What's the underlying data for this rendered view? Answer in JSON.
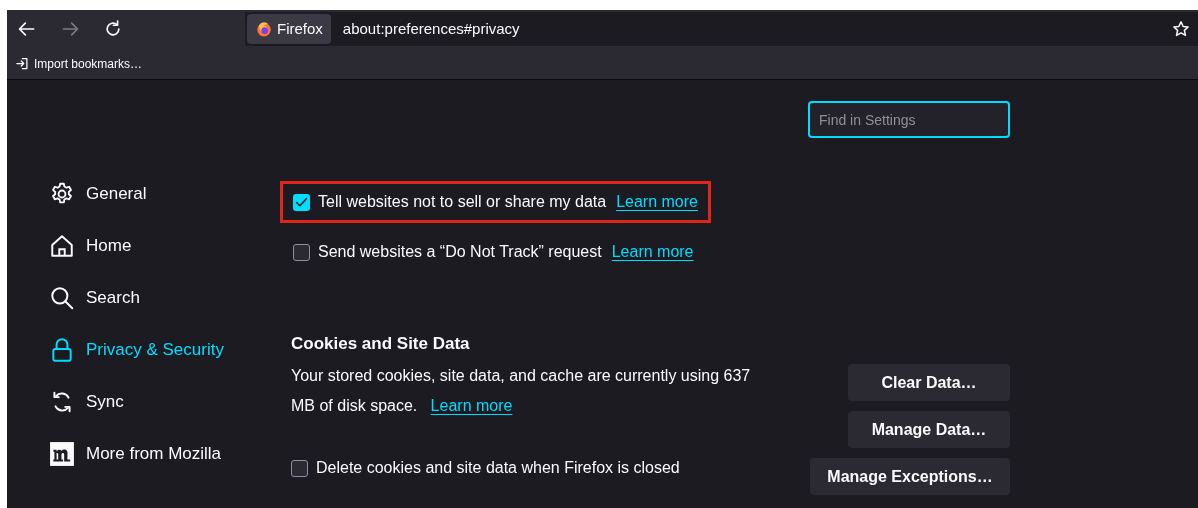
{
  "toolbar": {
    "identity_label": "Firefox",
    "url": "about:preferences#privacy",
    "forward_disabled": true
  },
  "bookmarks": [
    {
      "label": "Import bookmarks…"
    }
  ],
  "search": {
    "placeholder": "Find in Settings"
  },
  "sidebar": {
    "items": [
      {
        "kind": "general",
        "label": "General",
        "selected": false
      },
      {
        "kind": "home",
        "label": "Home",
        "selected": false
      },
      {
        "kind": "search",
        "label": "Search",
        "selected": false
      },
      {
        "kind": "privacy",
        "label": "Privacy & Security",
        "selected": true
      },
      {
        "kind": "sync",
        "label": "Sync",
        "selected": false
      },
      {
        "kind": "mozilla",
        "label": "More from Mozilla",
        "selected": false
      }
    ]
  },
  "privacy_options": [
    {
      "label": "Tell websites not to sell or share my data",
      "link": "Learn more",
      "checked": true,
      "highlighted": true
    },
    {
      "label": "Send websites a “Do Not Track” request",
      "link": "Learn more",
      "checked": false,
      "highlighted": false
    }
  ],
  "cookies": {
    "heading": "Cookies and Site Data",
    "description": "Your stored cookies, site data, and cache are currently using 637 MB of disk space.",
    "link": "Learn more",
    "buttons": [
      "Clear Data…",
      "Manage Data…",
      "Manage Exceptions…"
    ],
    "options": [
      {
        "label": "Delete cookies and site data when Firefox is closed",
        "checked": false
      }
    ]
  }
}
